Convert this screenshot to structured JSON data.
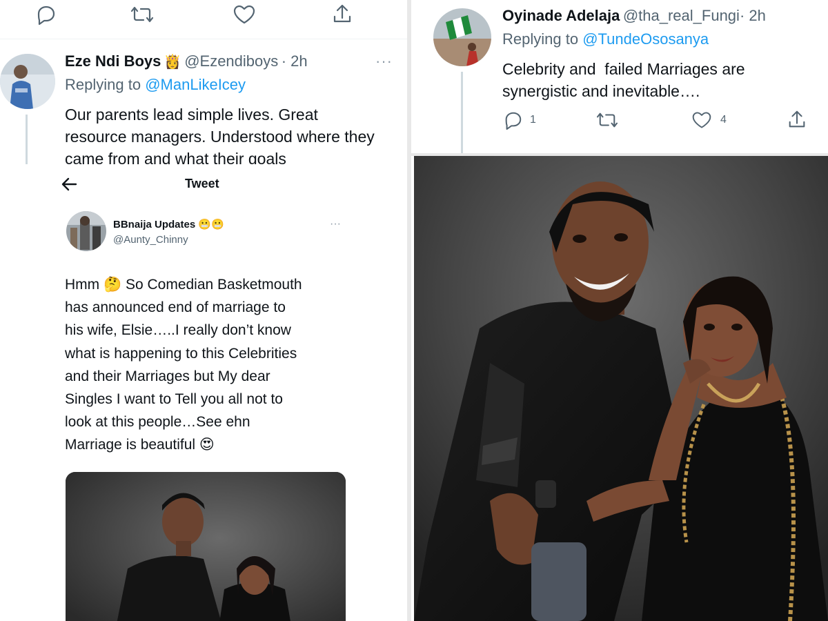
{
  "top_left": {
    "author": {
      "name": "Eze Ndi Boys",
      "badge": "👸",
      "handle": "@Ezendiboys",
      "time": "· 2h"
    },
    "replying_label": "Replying to",
    "replying_handle": "@ManLikeIcey",
    "text": "Our parents lead simple lives. Great resource managers. Understood where they came from and what their goals",
    "more": "···"
  },
  "bottom_left": {
    "header_title": "Tweet",
    "author": {
      "name": "BBnaija Updates 😬😬",
      "handle": "@Aunty_Chinny"
    },
    "more": "···",
    "text_lines": [
      "Hmm 🤔 So Comedian Basketmouth",
      "has announced end of marriage to",
      "his wife, Elsie…..I really don’t know",
      "what is happening to this Celebrities",
      "and their Marriages but My dear",
      "Singles I want to Tell you all not to",
      "look at this people…See ehn",
      "Marriage is beautiful 😍"
    ]
  },
  "top_right": {
    "author": {
      "name": "Oyinade Adelaja",
      "handle": "@tha_real_Fungi",
      "time": "· 2h"
    },
    "replying_label": "Replying to",
    "replying_handle": "@TundeOsosanya",
    "text_lines": [
      "Celebrity and  failed Marriages are",
      "synergistic and inevitable…."
    ],
    "reply_count": "1",
    "like_count": "4"
  },
  "colors": {
    "link": "#1d9bf0",
    "secondary_text": "#536471",
    "primary_text": "#0f1419",
    "photo_backdrop": "#3a3a3a"
  },
  "icons": [
    "reply-icon",
    "retweet-icon",
    "like-icon",
    "share-icon",
    "back-arrow-icon",
    "more-icon"
  ]
}
